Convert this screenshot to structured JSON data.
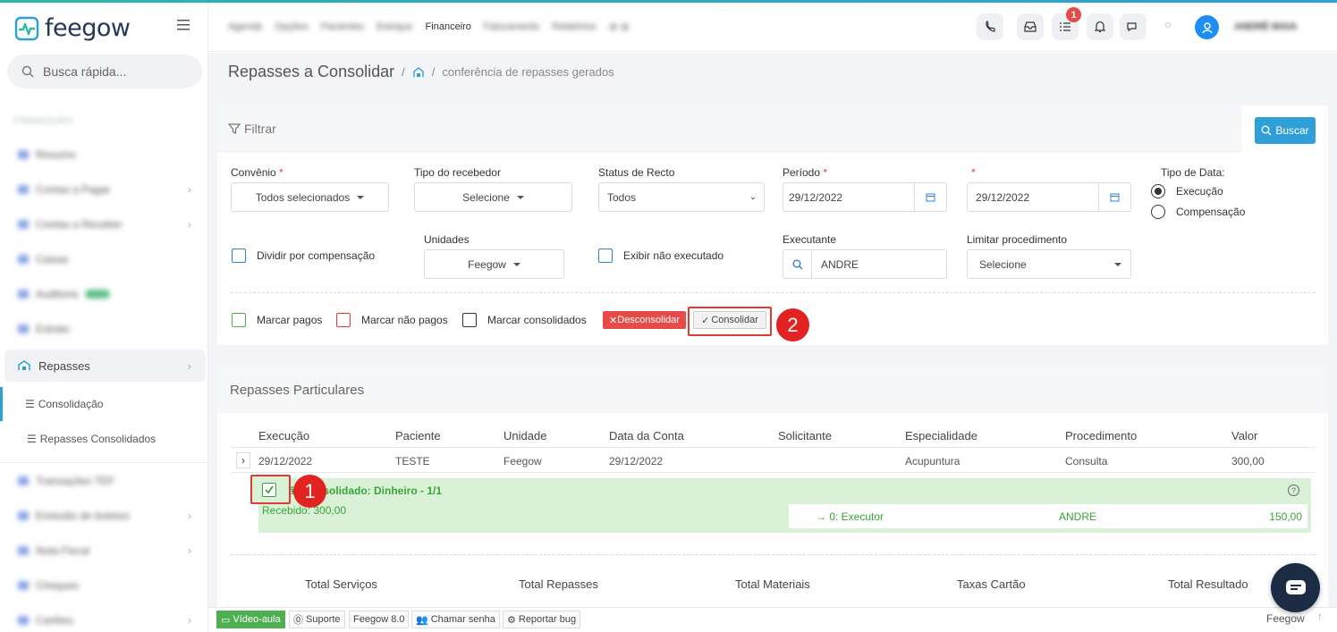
{
  "app": {
    "name": "feegow"
  },
  "search": {
    "placeholder": "Busca rápida..."
  },
  "topnav": {
    "items": [
      "Agenda",
      "Opções",
      "Pacientes",
      "Estoque",
      "Financeiro",
      "Faturamento",
      "Relatórios"
    ],
    "active": "Financeiro",
    "notification_count": "1",
    "user": "ANDRÉ MAIA"
  },
  "sidebar": {
    "section": "FINANCEIRO",
    "items": [
      "Resumo",
      "Contas a Pagar",
      "Contas a Receber",
      "Caixas",
      "Auditoria",
      "Extrato"
    ],
    "active": "Repasses",
    "sub_items": [
      "Consolidação",
      "Repasses Consolidados"
    ],
    "more_items": [
      "Transações TEF",
      "Emissão de boletos",
      "Nota Fiscal",
      "Cheques",
      "Cartões"
    ]
  },
  "breadcrumb": {
    "title": "Repasses a Consolidar",
    "sep": "/",
    "page": "conferência de repasses gerados"
  },
  "filter": {
    "header": "Filtrar",
    "buscar": "Buscar",
    "convenio": {
      "label": "Convênio",
      "value": "Todos selecionados"
    },
    "tipo_recebedor": {
      "label": "Tipo do recebedor",
      "value": "Selecione"
    },
    "status_recto": {
      "label": "Status de Recto",
      "value": "Todos"
    },
    "periodo": {
      "label": "Período",
      "from": "29/12/2022",
      "to": "29/12/2022"
    },
    "tipo_data": {
      "label": "Tipo de Data:",
      "options": [
        "Execução",
        "Compensação"
      ],
      "selected": "Execução"
    },
    "dividir": "Dividir por compensação",
    "unidades": {
      "label": "Unidades",
      "value": "Feegow"
    },
    "exibir": "Exibir não executado",
    "executante": {
      "label": "Executante",
      "value": "ANDRE"
    },
    "limitar": {
      "label": "Limitar procedimento",
      "value": "Selecione"
    },
    "marcar_pagos": "Marcar pagos",
    "marcar_nao_pagos": "Marcar não pagos",
    "marcar_consolidados": "Marcar consolidados",
    "desconsolidar": "Desconsolidar",
    "consolidar": "Consolidar"
  },
  "repasses": {
    "title": "Repasses Particulares",
    "columns": [
      "Execução",
      "Paciente",
      "Unidade",
      "Data da Conta",
      "Solicitante",
      "Especialidade",
      "Procedimento",
      "Valor"
    ],
    "row": {
      "execucao": "29/12/2022",
      "paciente": "TESTE",
      "unidade": "Feegow",
      "data_conta": "29/12/2022",
      "solicitante": "",
      "especialidade": "Acupuntura",
      "procedimento": "Consulta",
      "valor": "300,00"
    },
    "detail_title": "Não consolidado: Dinheiro - 1/1",
    "recebido": "Recebido: 300,00",
    "executor_label": "→ 0: Executor",
    "executor_name": "ANDRE",
    "executor_value": "150,00",
    "totals": [
      "Total Serviços",
      "Total Repasses",
      "Total Materiais",
      "Taxas Cartão",
      "Total Resultado"
    ]
  },
  "annotations": {
    "one": "1",
    "two": "2"
  },
  "footer": {
    "video": "Vídeo-aula",
    "suporte": "Suporte",
    "version": "Feegow 8.0",
    "chamar": "Chamar senha",
    "reportar": "Reportar bug",
    "brand": "Feegow"
  }
}
